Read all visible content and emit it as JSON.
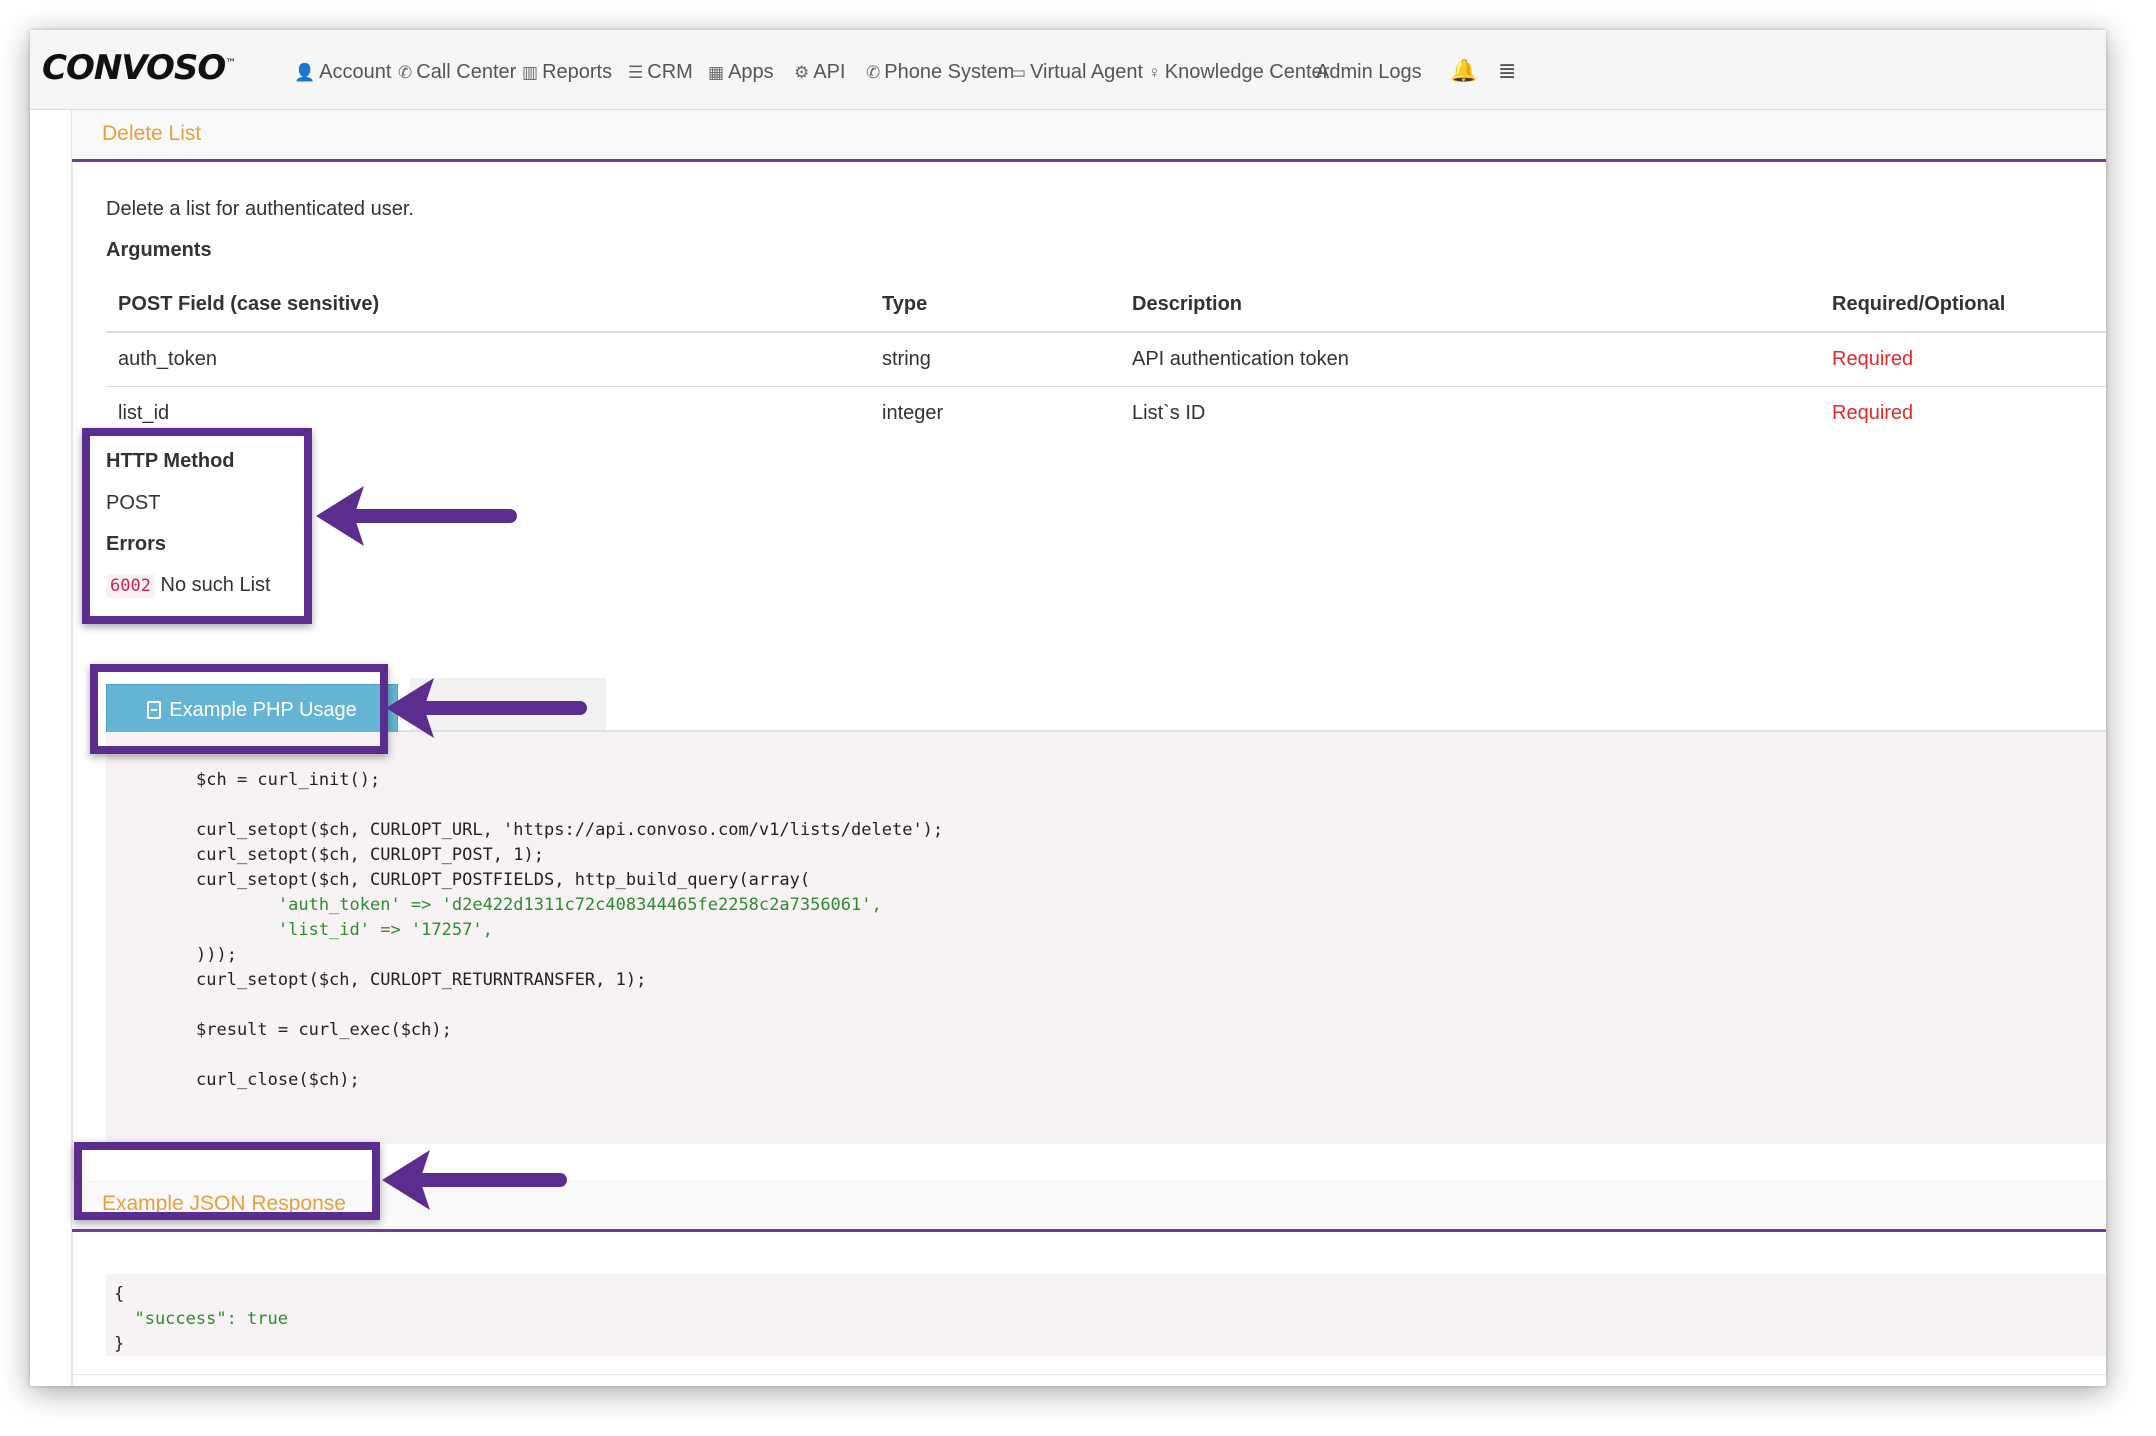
{
  "brand": {
    "name": "CONVOSO",
    "tm": "™"
  },
  "nav": [
    {
      "label": "Account",
      "icon": "user-icon",
      "glyph": "👤"
    },
    {
      "label": "Call Center",
      "icon": "phone-icon",
      "glyph": "✆"
    },
    {
      "label": "Reports",
      "icon": "bar-chart-icon",
      "glyph": "▥"
    },
    {
      "label": "CRM",
      "icon": "list-icon",
      "glyph": "☰"
    },
    {
      "label": "Apps",
      "icon": "grid-icon",
      "glyph": "▦"
    },
    {
      "label": "API",
      "icon": "gear-icon",
      "glyph": "⚙"
    },
    {
      "label": "Phone System",
      "icon": "phone-icon",
      "glyph": "✆"
    },
    {
      "label": "Virtual Agent",
      "icon": "monitor-icon",
      "glyph": "▭"
    },
    {
      "label": "Knowledge Center",
      "icon": "lightbulb-icon",
      "glyph": "♀"
    },
    {
      "label": "Admin Logs",
      "icon": "",
      "glyph": ""
    }
  ],
  "nav_right": {
    "bell_glyph": "🔔",
    "db_glyph": "≣"
  },
  "section": {
    "title": "Delete List",
    "description": "Delete a list for authenticated user.",
    "arguments_label": "Arguments",
    "columns": [
      "POST Field (case sensitive)",
      "Type",
      "Description",
      "Required/Optional"
    ],
    "rows": [
      {
        "field": "auth_token",
        "type": "string",
        "description": "API authentication token",
        "required": "Required"
      },
      {
        "field": "list_id",
        "type": "integer",
        "description": "List`s ID",
        "required": "Required"
      }
    ],
    "http_method_label": "HTTP Method",
    "http_method": "POST",
    "errors_label": "Errors",
    "error_code": "6002",
    "error_text": "No such List"
  },
  "php_tab": {
    "label": "Example PHP Usage"
  },
  "php_code": [
    "$ch = curl_init();",
    "",
    "curl_setopt($ch, CURLOPT_URL, 'https://api.convoso.com/v1/lists/delete');",
    "curl_setopt($ch, CURLOPT_POST, 1);",
    "curl_setopt($ch, CURLOPT_POSTFIELDS, http_build_query(array(",
    "        'auth_token' => 'd2e422d1311c72c408344465fe2258c2a7356061',",
    "        'list_id' => '17257',",
    ")));",
    "curl_setopt($ch, CURLOPT_RETURNTRANSFER, 1);",
    "",
    "$result = curl_exec($ch);",
    "",
    "curl_close($ch);"
  ],
  "json_section": {
    "title": "Example JSON Response"
  },
  "json_code": [
    "{",
    "  \"success\": true",
    "}"
  ],
  "annotation_color": "#5b2d8e",
  "accent_orange": "#e8a03c",
  "required_red": "#e02b2b"
}
